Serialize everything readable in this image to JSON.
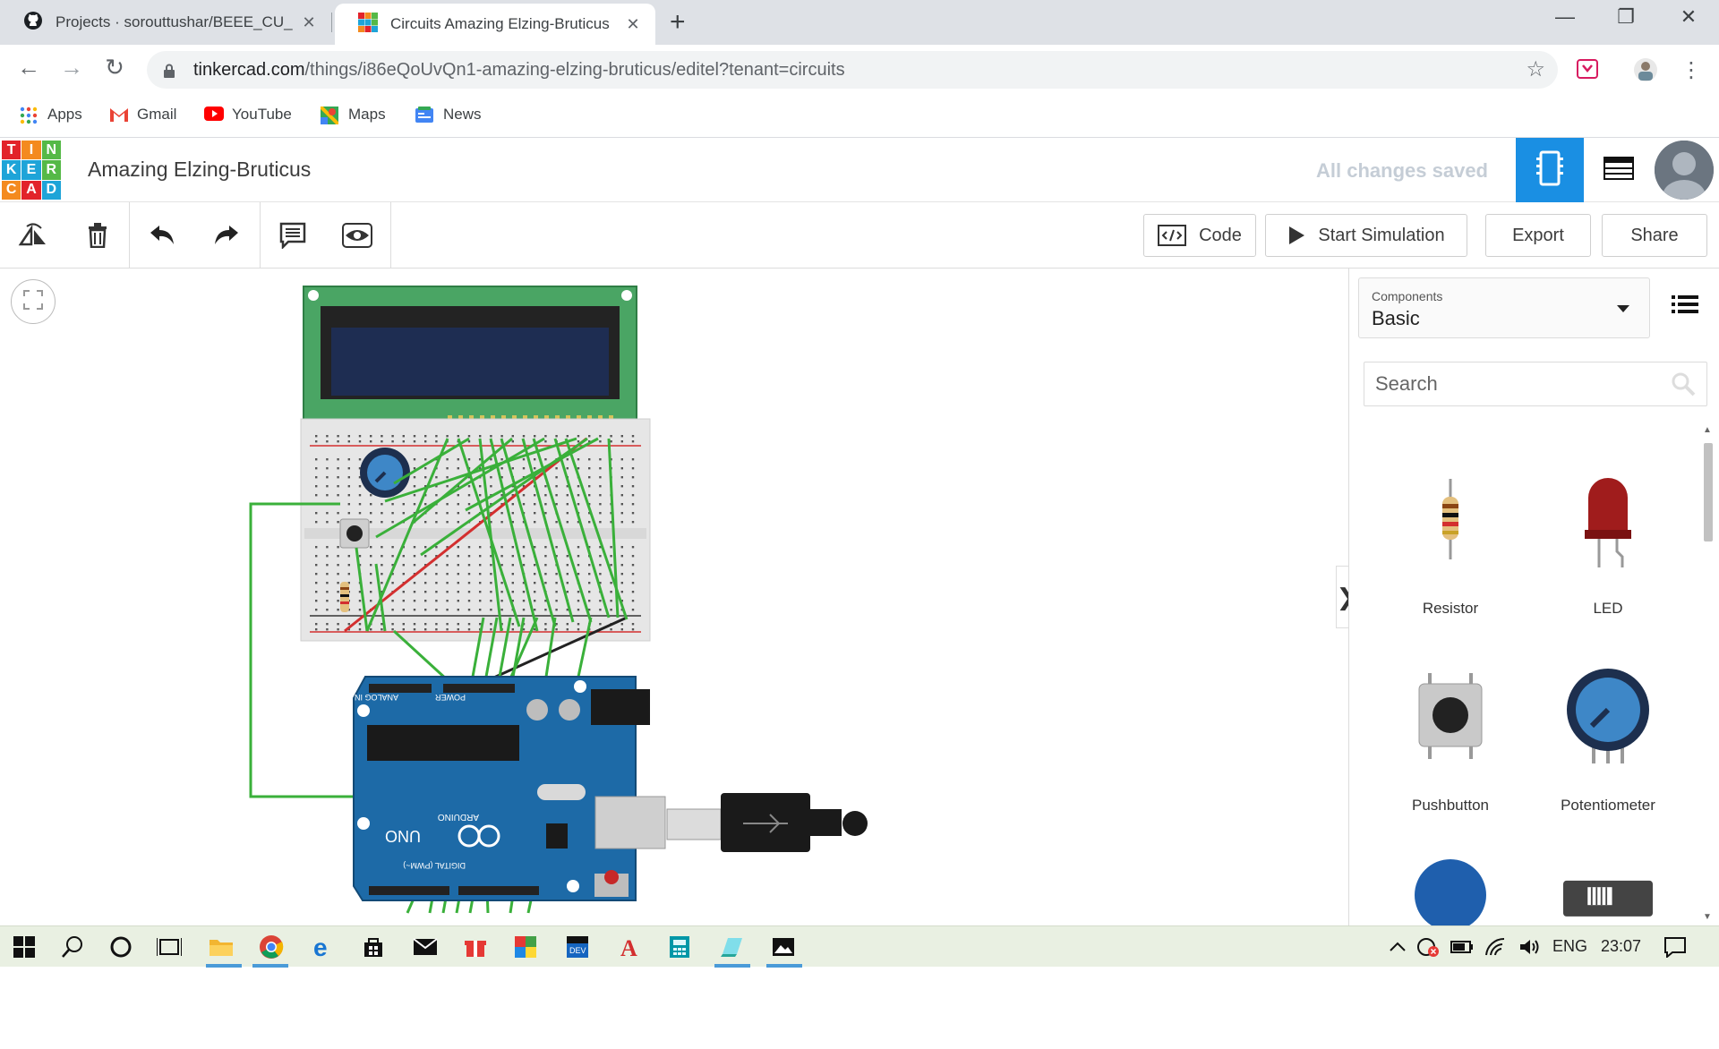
{
  "browser": {
    "tabs": [
      {
        "title": "Projects · sorouttushar/BEEE_CU_",
        "close": "✕"
      },
      {
        "title": "Circuits Amazing Elzing-Bruticus",
        "close": "✕"
      }
    ],
    "new_tab": "+",
    "window_controls": {
      "minimize": "—",
      "maximize": "❐",
      "close": "✕"
    },
    "nav": {
      "back": "←",
      "forward": "→",
      "reload": "↻"
    },
    "url_host": "tinkercad.com",
    "url_path": "/things/i86eQoUvQn1-amazing-elzing-bruticus/editel?tenant=circuits",
    "bookmark_star": "☆",
    "bookmarks": [
      {
        "label": "Apps",
        "icon": "apps-grid-icon"
      },
      {
        "label": "Gmail",
        "icon": "gmail-icon"
      },
      {
        "label": "YouTube",
        "icon": "youtube-icon"
      },
      {
        "label": "Maps",
        "icon": "maps-icon"
      },
      {
        "label": "News",
        "icon": "news-icon"
      }
    ]
  },
  "app": {
    "logo_letters": [
      "T",
      "I",
      "N",
      "K",
      "E",
      "R",
      "C",
      "A",
      "D"
    ],
    "logo_colors": [
      "#e2232a",
      "#f48a1f",
      "#55b947",
      "#1ea4d8",
      "#1ea4d8",
      "#55b947",
      "#f48a1f",
      "#e2232a",
      "#1ea4d8"
    ],
    "project_title": "Amazing Elzing-Bruticus",
    "save_status": "All changes saved",
    "accent": "#1a8fe3"
  },
  "toolbar": {
    "code_label": "Code",
    "start_simulation_label": "Start Simulation",
    "export_label": "Export",
    "share_label": "Share"
  },
  "panel": {
    "components_label": "Components",
    "components_value": "Basic",
    "search_placeholder": "Search",
    "items": [
      {
        "label": "Resistor"
      },
      {
        "label": "LED"
      },
      {
        "label": "Pushbutton"
      },
      {
        "label": "Potentiometer"
      }
    ],
    "collapse_arrow": "❯"
  },
  "canvas": {
    "arduino_text": {
      "analog_in": "ANALOG IN",
      "power": "POWER",
      "digital": "DIGITAL (PWM~)",
      "uno": "UNO",
      "brand": "ARDUINO"
    }
  },
  "taskbar": {
    "language": "ENG",
    "time": "23:07"
  }
}
